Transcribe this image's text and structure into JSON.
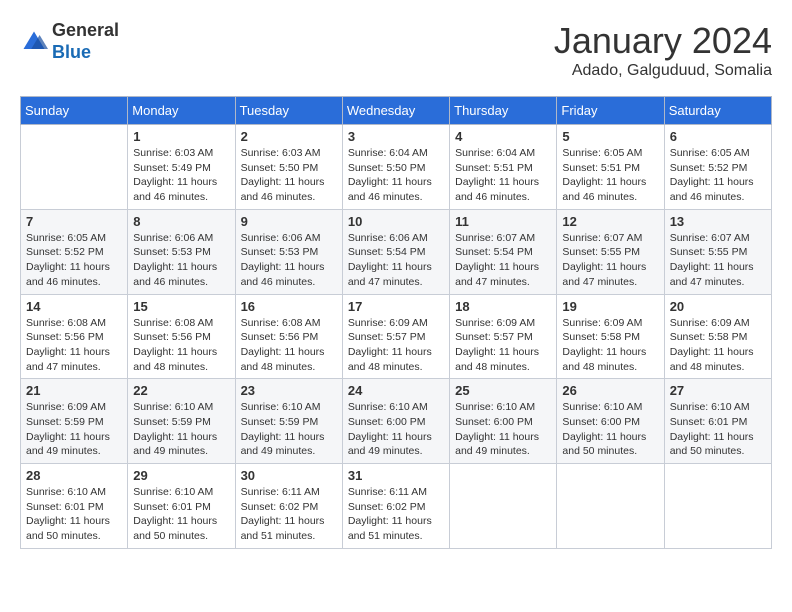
{
  "logo": {
    "general": "General",
    "blue": "Blue"
  },
  "title": "January 2024",
  "subtitle": "Adado, Galguduud, Somalia",
  "days_of_week": [
    "Sunday",
    "Monday",
    "Tuesday",
    "Wednesday",
    "Thursday",
    "Friday",
    "Saturday"
  ],
  "weeks": [
    [
      {
        "day": "",
        "info": ""
      },
      {
        "day": "1",
        "info": "Sunrise: 6:03 AM\nSunset: 5:49 PM\nDaylight: 11 hours\nand 46 minutes."
      },
      {
        "day": "2",
        "info": "Sunrise: 6:03 AM\nSunset: 5:50 PM\nDaylight: 11 hours\nand 46 minutes."
      },
      {
        "day": "3",
        "info": "Sunrise: 6:04 AM\nSunset: 5:50 PM\nDaylight: 11 hours\nand 46 minutes."
      },
      {
        "day": "4",
        "info": "Sunrise: 6:04 AM\nSunset: 5:51 PM\nDaylight: 11 hours\nand 46 minutes."
      },
      {
        "day": "5",
        "info": "Sunrise: 6:05 AM\nSunset: 5:51 PM\nDaylight: 11 hours\nand 46 minutes."
      },
      {
        "day": "6",
        "info": "Sunrise: 6:05 AM\nSunset: 5:52 PM\nDaylight: 11 hours\nand 46 minutes."
      }
    ],
    [
      {
        "day": "7",
        "info": "Sunrise: 6:05 AM\nSunset: 5:52 PM\nDaylight: 11 hours\nand 46 minutes."
      },
      {
        "day": "8",
        "info": "Sunrise: 6:06 AM\nSunset: 5:53 PM\nDaylight: 11 hours\nand 46 minutes."
      },
      {
        "day": "9",
        "info": "Sunrise: 6:06 AM\nSunset: 5:53 PM\nDaylight: 11 hours\nand 46 minutes."
      },
      {
        "day": "10",
        "info": "Sunrise: 6:06 AM\nSunset: 5:54 PM\nDaylight: 11 hours\nand 47 minutes."
      },
      {
        "day": "11",
        "info": "Sunrise: 6:07 AM\nSunset: 5:54 PM\nDaylight: 11 hours\nand 47 minutes."
      },
      {
        "day": "12",
        "info": "Sunrise: 6:07 AM\nSunset: 5:55 PM\nDaylight: 11 hours\nand 47 minutes."
      },
      {
        "day": "13",
        "info": "Sunrise: 6:07 AM\nSunset: 5:55 PM\nDaylight: 11 hours\nand 47 minutes."
      }
    ],
    [
      {
        "day": "14",
        "info": "Sunrise: 6:08 AM\nSunset: 5:56 PM\nDaylight: 11 hours\nand 47 minutes."
      },
      {
        "day": "15",
        "info": "Sunrise: 6:08 AM\nSunset: 5:56 PM\nDaylight: 11 hours\nand 48 minutes."
      },
      {
        "day": "16",
        "info": "Sunrise: 6:08 AM\nSunset: 5:56 PM\nDaylight: 11 hours\nand 48 minutes."
      },
      {
        "day": "17",
        "info": "Sunrise: 6:09 AM\nSunset: 5:57 PM\nDaylight: 11 hours\nand 48 minutes."
      },
      {
        "day": "18",
        "info": "Sunrise: 6:09 AM\nSunset: 5:57 PM\nDaylight: 11 hours\nand 48 minutes."
      },
      {
        "day": "19",
        "info": "Sunrise: 6:09 AM\nSunset: 5:58 PM\nDaylight: 11 hours\nand 48 minutes."
      },
      {
        "day": "20",
        "info": "Sunrise: 6:09 AM\nSunset: 5:58 PM\nDaylight: 11 hours\nand 48 minutes."
      }
    ],
    [
      {
        "day": "21",
        "info": "Sunrise: 6:09 AM\nSunset: 5:59 PM\nDaylight: 11 hours\nand 49 minutes."
      },
      {
        "day": "22",
        "info": "Sunrise: 6:10 AM\nSunset: 5:59 PM\nDaylight: 11 hours\nand 49 minutes."
      },
      {
        "day": "23",
        "info": "Sunrise: 6:10 AM\nSunset: 5:59 PM\nDaylight: 11 hours\nand 49 minutes."
      },
      {
        "day": "24",
        "info": "Sunrise: 6:10 AM\nSunset: 6:00 PM\nDaylight: 11 hours\nand 49 minutes."
      },
      {
        "day": "25",
        "info": "Sunrise: 6:10 AM\nSunset: 6:00 PM\nDaylight: 11 hours\nand 49 minutes."
      },
      {
        "day": "26",
        "info": "Sunrise: 6:10 AM\nSunset: 6:00 PM\nDaylight: 11 hours\nand 50 minutes."
      },
      {
        "day": "27",
        "info": "Sunrise: 6:10 AM\nSunset: 6:01 PM\nDaylight: 11 hours\nand 50 minutes."
      }
    ],
    [
      {
        "day": "28",
        "info": "Sunrise: 6:10 AM\nSunset: 6:01 PM\nDaylight: 11 hours\nand 50 minutes."
      },
      {
        "day": "29",
        "info": "Sunrise: 6:10 AM\nSunset: 6:01 PM\nDaylight: 11 hours\nand 50 minutes."
      },
      {
        "day": "30",
        "info": "Sunrise: 6:11 AM\nSunset: 6:02 PM\nDaylight: 11 hours\nand 51 minutes."
      },
      {
        "day": "31",
        "info": "Sunrise: 6:11 AM\nSunset: 6:02 PM\nDaylight: 11 hours\nand 51 minutes."
      },
      {
        "day": "",
        "info": ""
      },
      {
        "day": "",
        "info": ""
      },
      {
        "day": "",
        "info": ""
      }
    ]
  ]
}
